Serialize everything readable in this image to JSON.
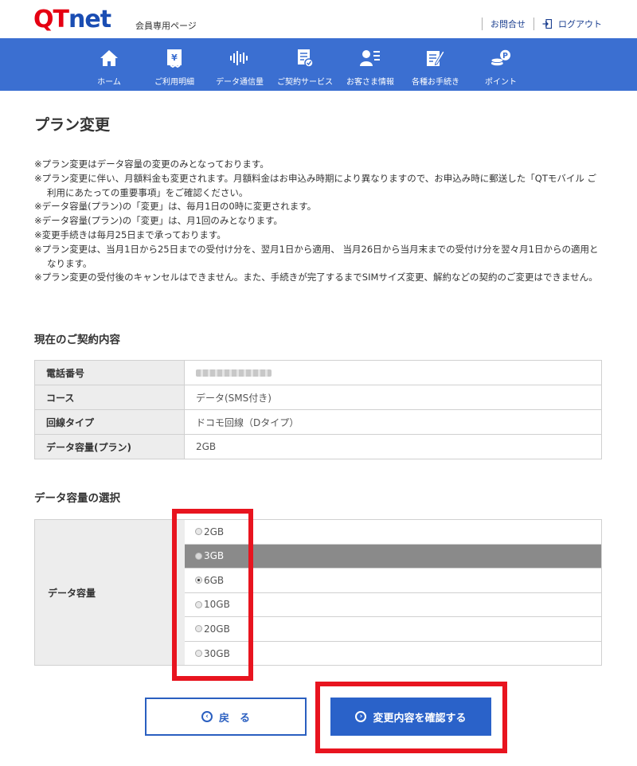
{
  "header": {
    "logo": {
      "q": "Q",
      "t": "T",
      "net": "net"
    },
    "site_sub": "会員専用ページ",
    "contact": "お問合せ",
    "logout": "ログアウト"
  },
  "nav": {
    "items": [
      {
        "label": "ホーム",
        "icon": "home-icon"
      },
      {
        "label": "ご利用明細",
        "icon": "bill-icon"
      },
      {
        "label": "データ通信量",
        "icon": "wave-icon"
      },
      {
        "label": "ご契約サービス",
        "icon": "contract-icon"
      },
      {
        "label": "お客さま情報",
        "icon": "user-icon"
      },
      {
        "label": "各種お手続き",
        "icon": "form-icon"
      },
      {
        "label": "ポイント",
        "icon": "point-icon"
      }
    ]
  },
  "page": {
    "title": "プラン変更",
    "notes": [
      "※プラン変更はデータ容量の変更のみとなっております。",
      "※プラン変更に伴い、月額料金も変更されます。月額料金はお申込み時期により異なりますので、お申込み時に郵送した「QTモバイル ご利用にあたっての重要事項」をご確認ください。",
      "※データ容量(プラン)の「変更」は、毎月1日の0時に変更されます。",
      "※データ容量(プラン)の「変更」は、月1回のみとなります。",
      "※変更手続きは毎月25日まで承っております。",
      "※プラン変更は、当月1日から25日までの受付け分を、翌月1日から適用、 当月26日から当月末までの受付け分を翌々月1日からの適用となります。",
      "※プラン変更の受付後のキャンセルはできません。また、手続きが完了するまでSIMサイズ変更、解約などの契約のご変更はできません。"
    ]
  },
  "contract": {
    "title": "現在のご契約内容",
    "rows": [
      {
        "key": "電話番号",
        "value": ""
      },
      {
        "key": "コース",
        "value": "データ(SMS付き)"
      },
      {
        "key": "回線タイプ",
        "value": "ドコモ回線（Dタイプ）"
      },
      {
        "key": "データ容量(プラン)",
        "value": "2GB"
      }
    ]
  },
  "selection": {
    "title": "データ容量の選択",
    "key": "データ容量",
    "options": [
      {
        "label": "2GB",
        "selected": false,
        "highlighted": false
      },
      {
        "label": "3GB",
        "selected": false,
        "highlighted": true
      },
      {
        "label": "6GB",
        "selected": true,
        "highlighted": false
      },
      {
        "label": "10GB",
        "selected": false,
        "highlighted": false
      },
      {
        "label": "20GB",
        "selected": false,
        "highlighted": false
      },
      {
        "label": "30GB",
        "selected": false,
        "highlighted": false
      }
    ]
  },
  "buttons": {
    "back": "戻　る",
    "back_icon": "‹",
    "confirm": "変更内容を確認する",
    "confirm_icon": "›"
  },
  "colors": {
    "brand_red": "#e50012",
    "brand_blue": "#1a4db3",
    "nav_bg": "#3b6fd1",
    "primary_button": "#2a62c9",
    "annotation_red": "#e8141f"
  }
}
